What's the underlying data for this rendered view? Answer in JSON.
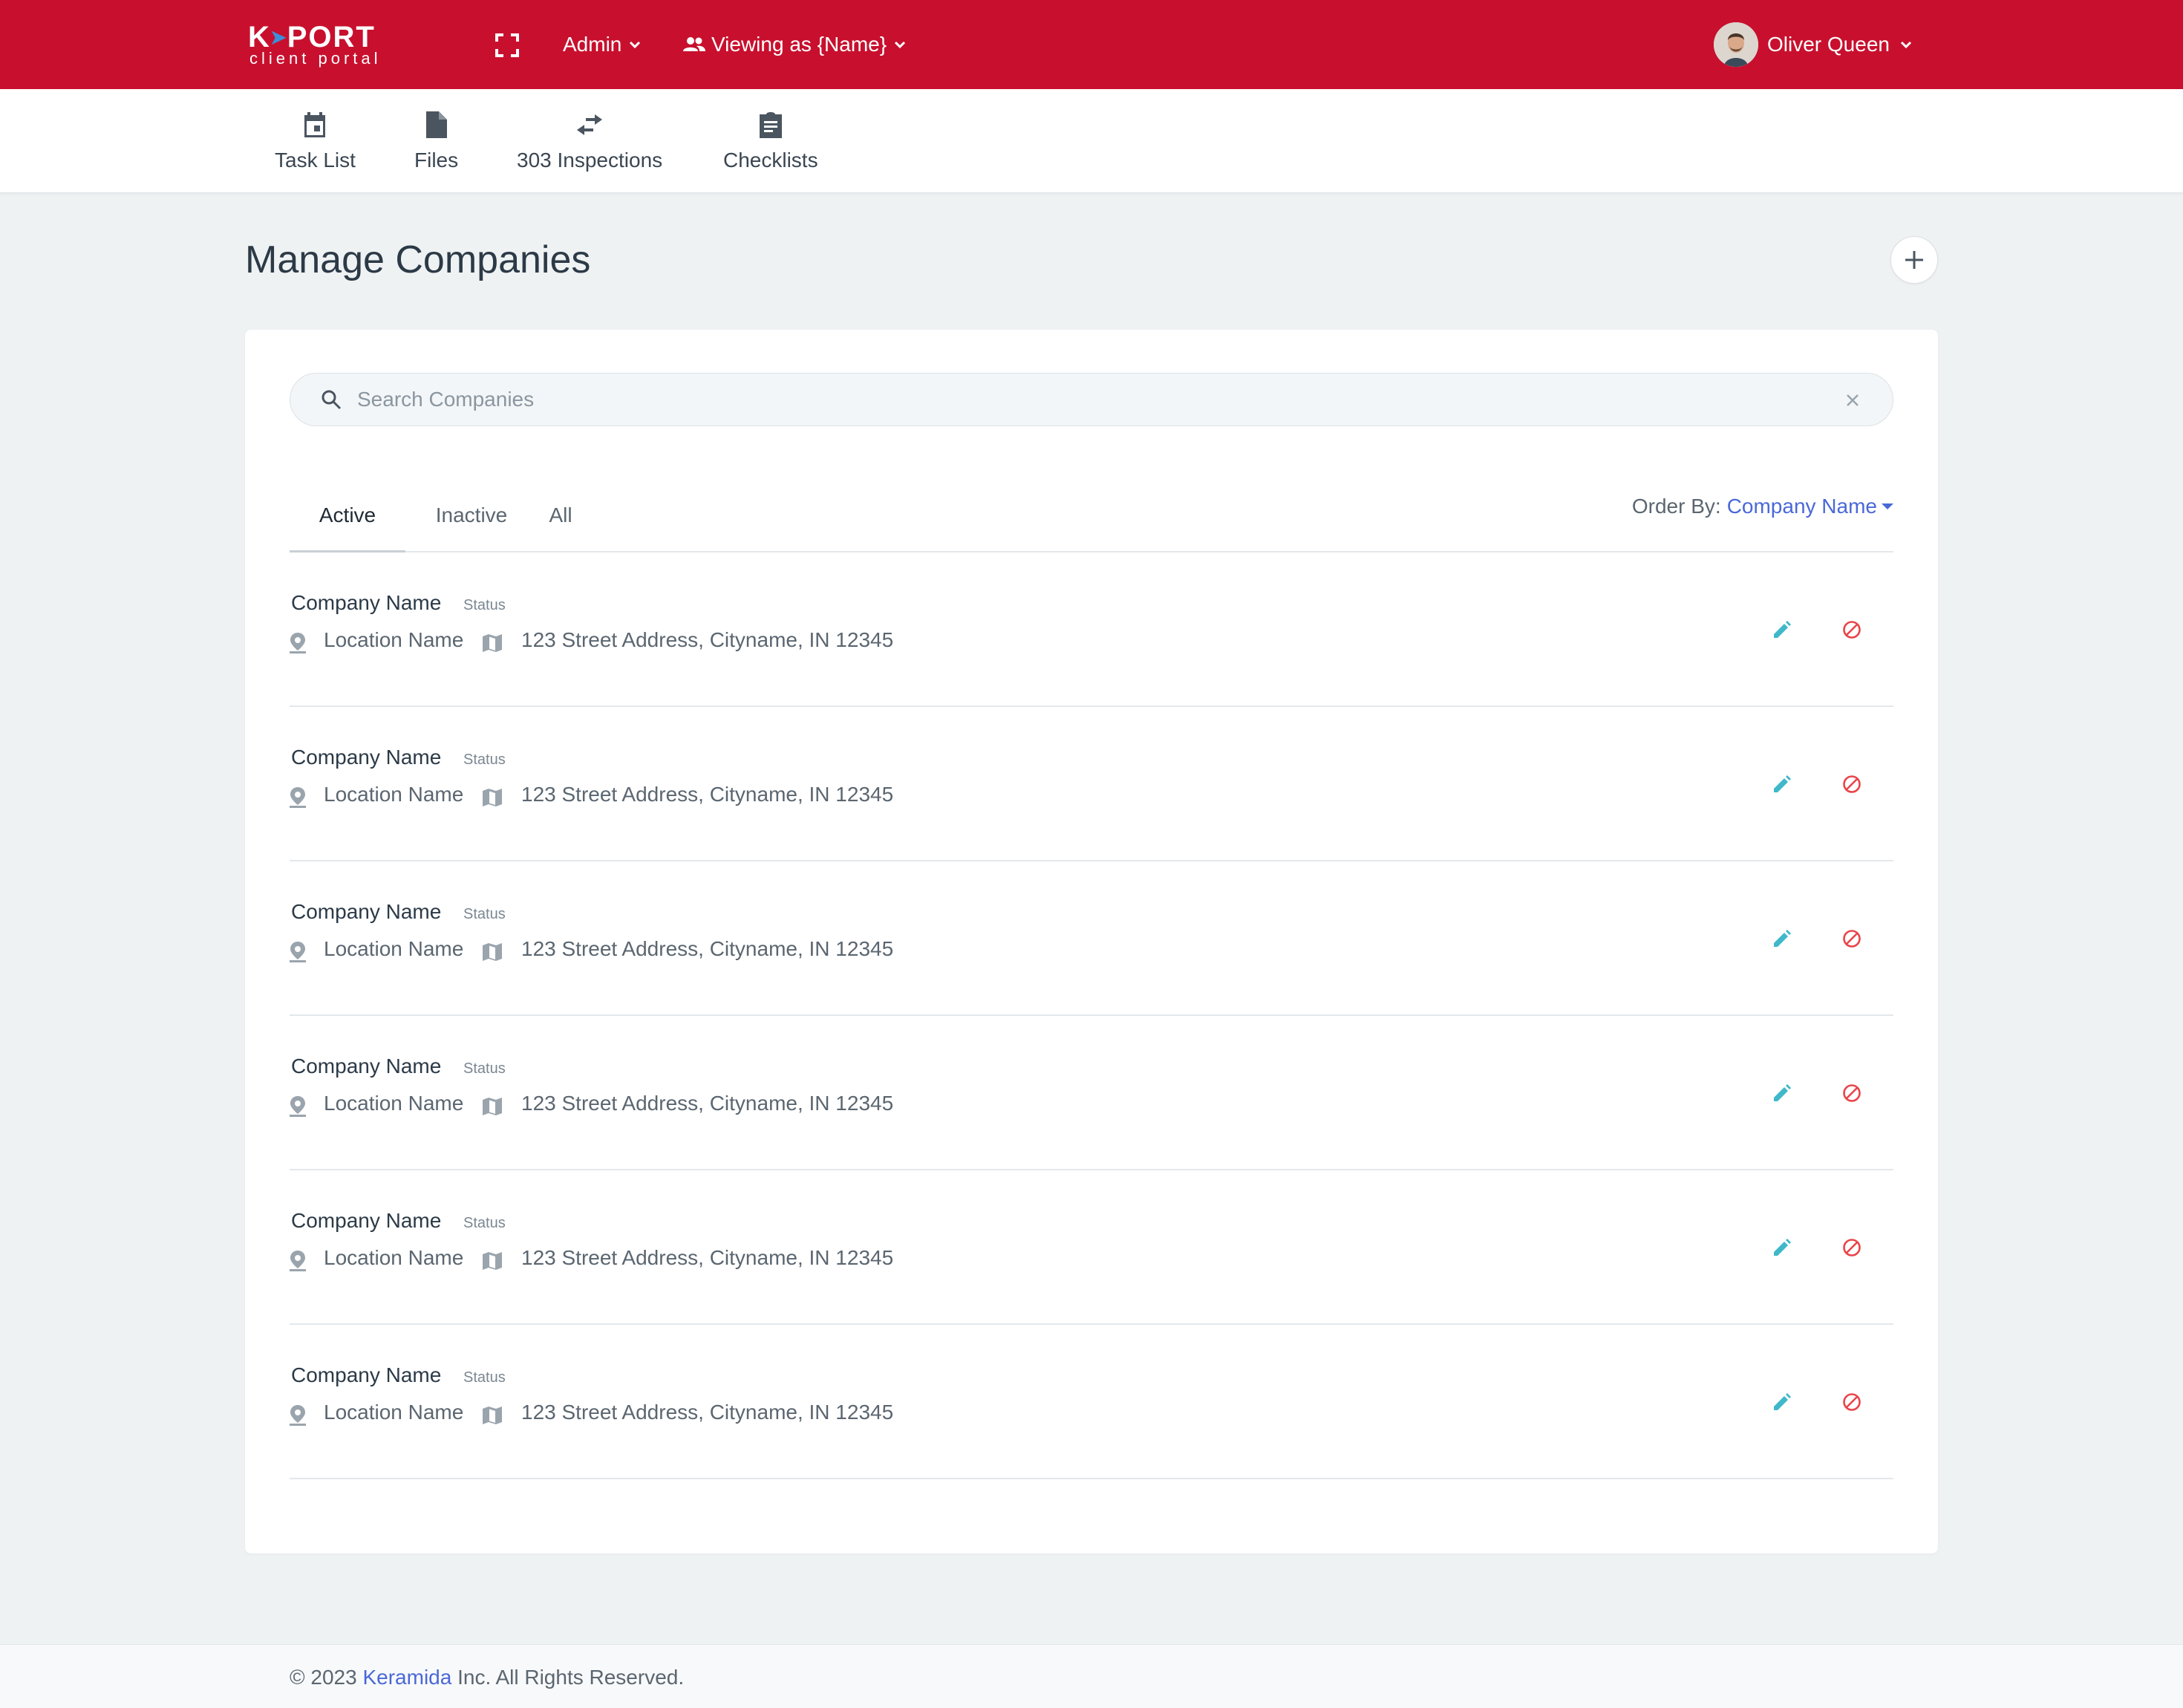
{
  "app": {
    "logo_main_left": "K",
    "logo_arrow": "➤",
    "logo_main_right": "PORT",
    "logo_sub": "client portal"
  },
  "topbar": {
    "admin_label": "Admin",
    "viewing_label": "Viewing as {Name}",
    "user_name": "Oliver Queen",
    "background": "#c8102e"
  },
  "subnav": {
    "items": [
      {
        "label": "Task List",
        "icon": "calendar-icon"
      },
      {
        "label": "Files",
        "icon": "file-icon"
      },
      {
        "label": "303 Inspections",
        "icon": "swap-arrows-icon"
      },
      {
        "label": "Checklists",
        "icon": "clipboard-icon"
      }
    ]
  },
  "page": {
    "title": "Manage Companies"
  },
  "search": {
    "placeholder": "Search Companies",
    "value": ""
  },
  "tabs": {
    "active": "Active",
    "inactive": "Inactive",
    "all": "All",
    "selected": "Active"
  },
  "order": {
    "label": "Order By:",
    "value": "Company Name",
    "accent": "#4a68d8"
  },
  "companies": [
    {
      "name": "Company Name",
      "status": "Status",
      "location": "Location Name",
      "address": "123 Street Address, Cityname, IN 12345"
    },
    {
      "name": "Company Name",
      "status": "Status",
      "location": "Location Name",
      "address": "123 Street Address, Cityname, IN 12345"
    },
    {
      "name": "Company Name",
      "status": "Status",
      "location": "Location Name",
      "address": "123 Street Address, Cityname, IN 12345"
    },
    {
      "name": "Company Name",
      "status": "Status",
      "location": "Location Name",
      "address": "123 Street Address, Cityname, IN 12345"
    },
    {
      "name": "Company Name",
      "status": "Status",
      "location": "Location Name",
      "address": "123 Street Address, Cityname, IN 12345"
    },
    {
      "name": "Company Name",
      "status": "Status",
      "location": "Location Name",
      "address": "123 Street Address, Cityname, IN 12345"
    }
  ],
  "row_actions": {
    "edit_icon": "pencil-icon",
    "edit_color": "#3fb8c9",
    "disable_icon": "block-icon",
    "disable_color": "#e8454a"
  },
  "footer": {
    "prefix": "© 2023 ",
    "brand": "Keramida",
    "suffix": " Inc. All Rights Reserved."
  }
}
